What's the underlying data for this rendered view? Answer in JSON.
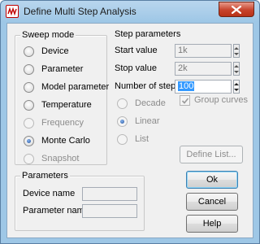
{
  "window": {
    "title": "Define Multi Step Analysis"
  },
  "sweep_mode": {
    "label": "Sweep mode",
    "options": [
      {
        "label": "Device",
        "checked": false,
        "enabled": true
      },
      {
        "label": "Parameter",
        "checked": false,
        "enabled": true
      },
      {
        "label": "Model parameter",
        "checked": false,
        "enabled": true
      },
      {
        "label": "Temperature",
        "checked": false,
        "enabled": true
      },
      {
        "label": "Frequency",
        "checked": false,
        "enabled": false
      },
      {
        "label": "Monte Carlo",
        "checked": true,
        "enabled": true
      },
      {
        "label": "Snapshot",
        "checked": false,
        "enabled": false
      }
    ]
  },
  "step_parameters": {
    "label": "Step parameters",
    "start_value": {
      "label": "Start value",
      "value": "1k"
    },
    "stop_value": {
      "label": "Stop value",
      "value": "2k"
    },
    "number_of_steps": {
      "label": "Number of steps",
      "value": "100"
    },
    "step_type": [
      {
        "label": "Decade",
        "checked": false
      },
      {
        "label": "Linear",
        "checked": true
      },
      {
        "label": "List",
        "checked": false
      }
    ],
    "group_curves": {
      "label": "Group curves",
      "checked": true
    },
    "define_list_label": "Define List..."
  },
  "parameters": {
    "label": "Parameters",
    "device_name": {
      "label": "Device name",
      "value": ""
    },
    "parameter_name": {
      "label": "Parameter name",
      "value": ""
    }
  },
  "buttons": {
    "ok": "Ok",
    "cancel": "Cancel",
    "help": "Help"
  },
  "colors": {
    "titlebar": "#9ec7e6",
    "selection": "#3399ff",
    "close": "#c7432c"
  }
}
